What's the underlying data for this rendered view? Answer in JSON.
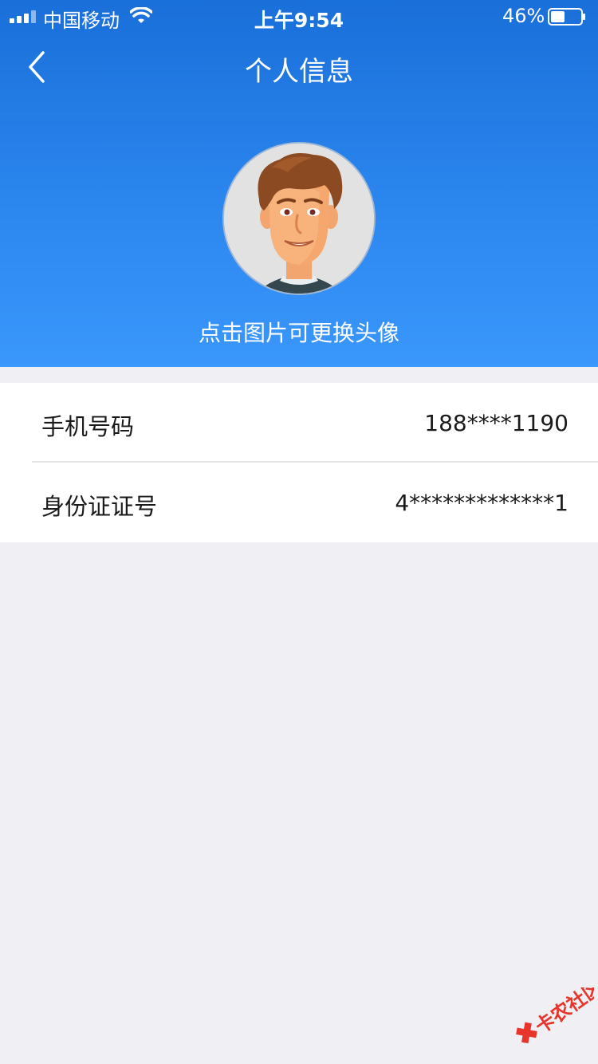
{
  "status_bar": {
    "carrier": "中国移动",
    "time": "上午9:54",
    "battery_percent": "46%",
    "battery_level": 0.46,
    "signal_icon": "signal-bars-icon",
    "wifi_icon": "wifi-icon",
    "battery_icon": "battery-icon"
  },
  "nav": {
    "title": "个人信息",
    "back_icon": "chevron-left-icon"
  },
  "profile": {
    "avatar_icon": "cartoon-avatar",
    "hint": "点击图片可更换头像"
  },
  "info": {
    "rows": [
      {
        "label": "手机号码",
        "value": "188****1190"
      },
      {
        "label": "身份证证号",
        "value": "4*************1"
      }
    ]
  },
  "watermark": {
    "text": "卡农社区"
  },
  "colors": {
    "header_top": "#1a6fd9",
    "header_bottom": "#3a97fb",
    "page_bg": "#efeff4",
    "watermark_red": "#e8352b"
  }
}
